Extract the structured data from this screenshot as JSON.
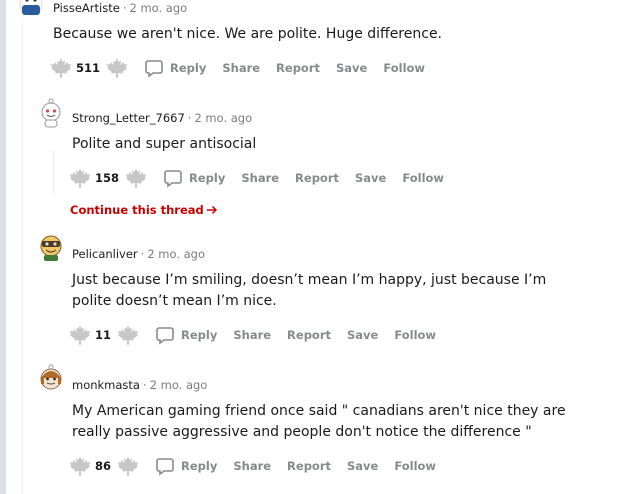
{
  "comments": [
    {
      "author": "PisseArtiste",
      "time": "2 mo. ago",
      "body": "Because we aren't nice. We are polite. Huge difference.",
      "score": "511",
      "actions": {
        "reply": "Reply",
        "share": "Share",
        "report": "Report",
        "save": "Save",
        "follow": "Follow"
      }
    },
    {
      "author": "Strong_Letter_7667",
      "time": "2 mo. ago",
      "body": "Polite and super antisocial",
      "score": "158",
      "actions": {
        "reply": "Reply",
        "share": "Share",
        "report": "Report",
        "save": "Save",
        "follow": "Follow"
      }
    },
    {
      "author": "Pelicanliver",
      "time": "2 mo. ago",
      "body": "Just because I’m smiling, doesn’t mean I’m happy, just because I’m polite doesn’t mean I’m nice.",
      "score": "11",
      "actions": {
        "reply": "Reply",
        "share": "Share",
        "report": "Report",
        "save": "Save",
        "follow": "Follow"
      }
    },
    {
      "author": "monkmasta",
      "time": "2 mo. ago",
      "body": "My American gaming friend once said \" canadians aren't nice they are really passive aggressive and people don't notice the difference \"",
      "score": "86",
      "actions": {
        "reply": "Reply",
        "share": "Share",
        "report": "Report",
        "save": "Save",
        "follow": "Follow"
      }
    }
  ],
  "continue_thread": "Continue this thread",
  "icons": {
    "upvote": "maple-leaf-upvote-icon",
    "downvote": "maple-leaf-downvote-icon",
    "reply": "speech-bubble-icon",
    "continue": "arrow-right-icon"
  },
  "colors": {
    "continue_link": "#cc0000",
    "vote_icon": "#c7c7c7",
    "action_text": "#878a8c"
  }
}
